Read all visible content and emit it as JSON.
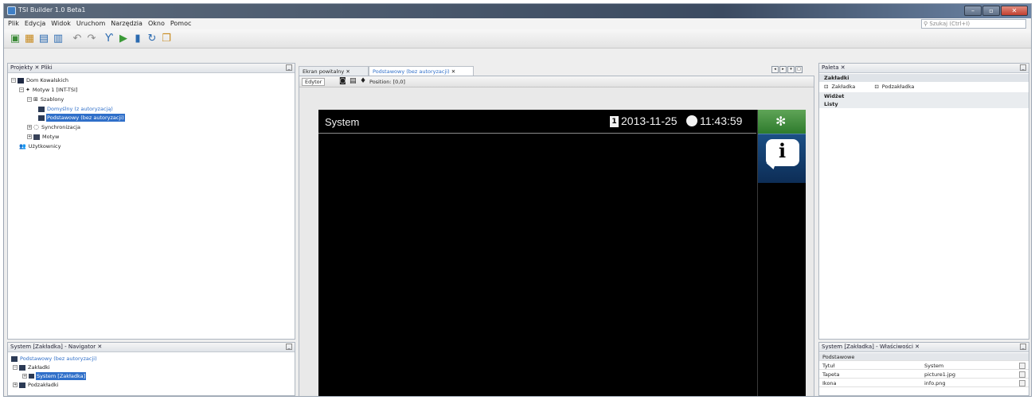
{
  "window": {
    "title": "TSI Builder 1.0 Beta1"
  },
  "menu": [
    "Plik",
    "Edycja",
    "Widok",
    "Uruchom",
    "Narzędzia",
    "Okno",
    "Pomoc"
  ],
  "search": {
    "placeholder": "Szukaj (Ctrl+I)"
  },
  "toolbar": {
    "icons": [
      "new-project-icon",
      "open-project-icon",
      "save-icon",
      "save-all-icon",
      "undo-icon",
      "redo-icon",
      "filter-icon",
      "run-icon",
      "stop-icon",
      "refresh-icon",
      "copy-icon"
    ]
  },
  "projects": {
    "tabs": [
      "Projekty",
      "Pliki"
    ],
    "tree": [
      {
        "label": "Dom Kowalskich",
        "level": 0
      },
      {
        "label": "Motyw 1 [INT-TSI]",
        "level": 1
      },
      {
        "label": "Szablony",
        "level": 2
      },
      {
        "label": "Domyślny (z autoryzacją)",
        "level": 3
      },
      {
        "label": "Podstawowy (bez autoryzacji)",
        "level": 3
      },
      {
        "label": "Synchronizacja",
        "level": 2
      },
      {
        "label": "Motyw",
        "level": 2
      },
      {
        "label": "Użytkownicy",
        "level": 1
      }
    ]
  },
  "navigator": {
    "title": "System [Zakładka] - Navigator",
    "tree": [
      {
        "label": "Podstawowy (bez autoryzacji)"
      },
      {
        "label": "Zakładki"
      },
      {
        "label": "System [Zakładka]"
      },
      {
        "label": "Podzakładki"
      }
    ]
  },
  "editor": {
    "tabs": [
      "Ekran powitalny",
      "Podstawowy (bez autoryzacji)"
    ],
    "subtabs": [
      "Edytor"
    ],
    "position_label": "Position: [0,0]",
    "screen": {
      "title": "System",
      "date": "2013-11-25",
      "time": "11:43:59",
      "calendar_day": "1"
    }
  },
  "palette": {
    "title": "Paleta",
    "categories": [
      "Zakładki",
      "Widżet",
      "Listy"
    ],
    "items": [
      "Zakładka",
      "Podzakładka"
    ]
  },
  "properties": {
    "title": "System [Zakładka] - Właściwości",
    "section": "Podstawowe",
    "rows": [
      {
        "key": "Tytuł",
        "value": "System"
      },
      {
        "key": "Tapeta",
        "value": "picture1.jpg"
      },
      {
        "key": "Ikona",
        "value": "info.png"
      }
    ]
  },
  "colors": {
    "accent": "#2f6fc9",
    "gear_tab": "#3b8a37",
    "info_tab": "#14406f"
  }
}
